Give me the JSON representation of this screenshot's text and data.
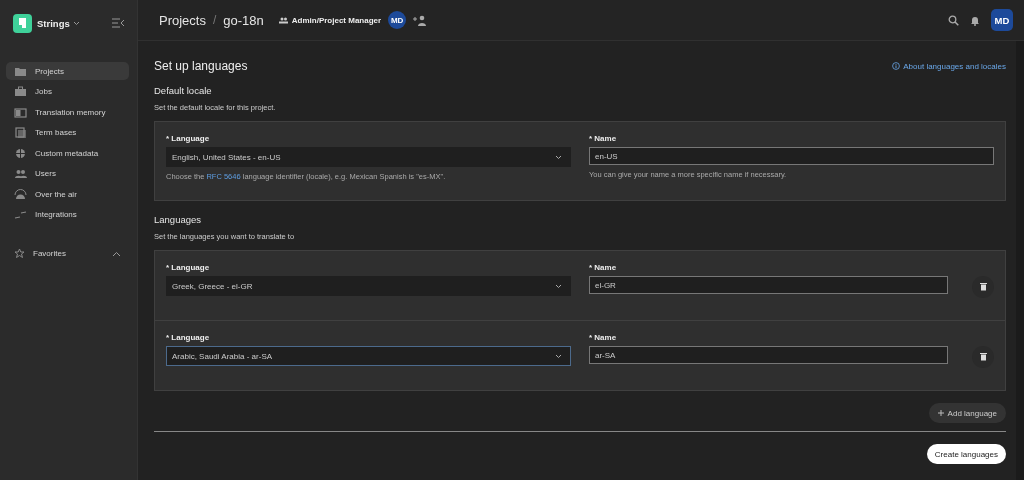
{
  "sidebar": {
    "app_name": "Strings",
    "items": [
      {
        "label": "Projects",
        "selected": true
      },
      {
        "label": "Jobs",
        "selected": false
      },
      {
        "label": "Translation memory",
        "selected": false
      },
      {
        "label": "Term bases",
        "selected": false
      },
      {
        "label": "Custom metadata",
        "selected": false
      },
      {
        "label": "Users",
        "selected": false
      },
      {
        "label": "Over the air",
        "selected": false
      },
      {
        "label": "Integrations",
        "selected": false
      }
    ],
    "favorites": {
      "label": "Favorites",
      "expanded": true
    }
  },
  "header": {
    "breadcrumb": [
      "Projects",
      "go-18n"
    ],
    "breadcrumb_separator": "/",
    "role": "Admin/Project Manager",
    "member_avatar": "MD",
    "user_avatar": "MD"
  },
  "page": {
    "title": "Set up languages",
    "help_link": "About languages and locales"
  },
  "default_locale": {
    "heading": "Default locale",
    "description": "Set the default locale for this project.",
    "language_label": "* Language",
    "language_value": "English, United States - en-US",
    "hint_before": "Choose the ",
    "hint_link": "RFC 5646",
    "hint_after": " language identifier (locale), e.g. Mexican Spanish is \"es-MX\".",
    "name_label": "* Name",
    "name_value": "en-US",
    "name_hint": "You can give your name a more specific name if necessary."
  },
  "languages": {
    "heading": "Languages",
    "description": "Set the languages you want to translate to",
    "rows": [
      {
        "language_label": "* Language",
        "language_value": "Greek, Greece - el-GR",
        "name_label": "* Name",
        "name_value": "el-GR",
        "focused": false
      },
      {
        "language_label": "* Language",
        "language_value": "Arabic, Saudi Arabia - ar-SA",
        "name_label": "* Name",
        "name_value": "ar-SA",
        "focused": true
      }
    ]
  },
  "buttons": {
    "add_language": "Add language",
    "create": "Create languages"
  }
}
